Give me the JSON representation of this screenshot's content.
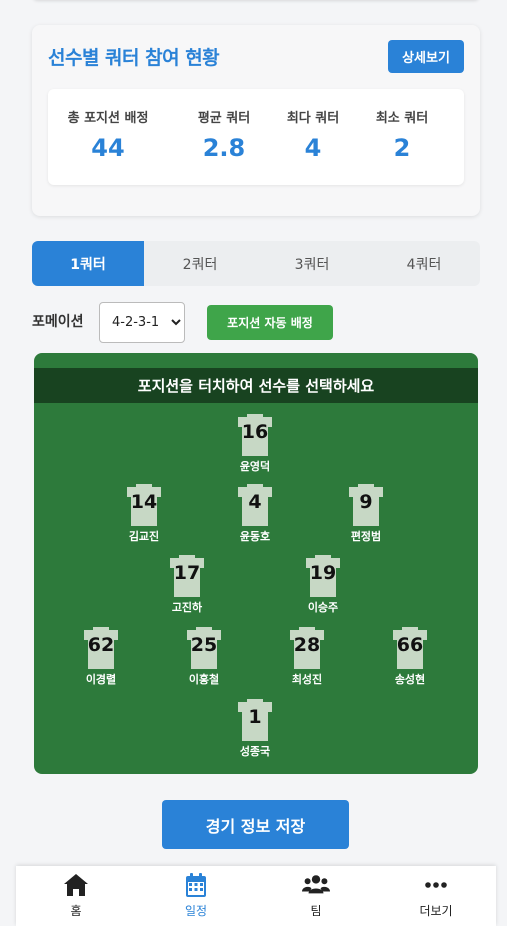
{
  "stats": {
    "title": "선수별 쿼터 참여 현황",
    "detail_button": "상세보기",
    "items": [
      {
        "label": "총 포지션 배정",
        "value": "44"
      },
      {
        "label": "평균 쿼터",
        "value": "2.8"
      },
      {
        "label": "최다 쿼터",
        "value": "4"
      },
      {
        "label": "최소 쿼터",
        "value": "2"
      }
    ]
  },
  "tabs": [
    {
      "label": "1쿼터",
      "active": true
    },
    {
      "label": "2쿼터",
      "active": false
    },
    {
      "label": "3쿼터",
      "active": false
    },
    {
      "label": "4쿼터",
      "active": false
    }
  ],
  "formation": {
    "label": "포메이션",
    "selected": "4-2-3-1",
    "auto_button": "포지션 자동 배정"
  },
  "pitch": {
    "instruction": "포지션을 터치하여 선수를 선택하세요",
    "players": [
      {
        "number": "16",
        "name": "윤영덕"
      },
      {
        "number": "14",
        "name": "김교진"
      },
      {
        "number": "4",
        "name": "윤동호"
      },
      {
        "number": "9",
        "name": "편정범"
      },
      {
        "number": "17",
        "name": "고진하"
      },
      {
        "number": "19",
        "name": "이승주"
      },
      {
        "number": "62",
        "name": "이경렬"
      },
      {
        "number": "25",
        "name": "이홍철"
      },
      {
        "number": "28",
        "name": "최성진"
      },
      {
        "number": "66",
        "name": "송성현"
      },
      {
        "number": "1",
        "name": "성종국"
      }
    ]
  },
  "save_button": "경기 정보 저장",
  "nav": [
    {
      "label": "홈",
      "icon": "home-icon",
      "active": false
    },
    {
      "label": "일정",
      "icon": "calendar-icon",
      "active": true
    },
    {
      "label": "팀",
      "icon": "users-icon",
      "active": false
    },
    {
      "label": "더보기",
      "icon": "more-icon",
      "active": false
    }
  ],
  "colors": {
    "accent": "#2a82d7",
    "auto_button": "#3fa54a",
    "pitch": "#2d7a3b",
    "jersey": "#c7d8c5"
  }
}
